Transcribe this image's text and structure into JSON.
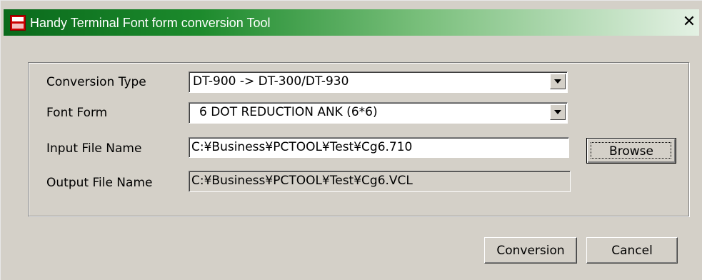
{
  "window": {
    "title": "Handy Terminal Font form conversion Tool",
    "close_symbol": "✕",
    "icon": "app-icon"
  },
  "form": {
    "conversion_type": {
      "label": "Conversion Type",
      "value": "DT-900 -> DT-300/DT-930"
    },
    "font_form": {
      "label": "Font Form",
      "value": "6 DOT REDUCTION ANK (6*6)"
    },
    "input_file": {
      "label": "Input File Name",
      "value": "C:¥Business¥PCTOOL¥Test¥Cg6.710"
    },
    "output_file": {
      "label": "Output File Name",
      "value": "C:¥Business¥PCTOOL¥Test¥Cg6.VCL"
    }
  },
  "buttons": {
    "browse": "Browse",
    "conversion": "Conversion",
    "cancel": "Cancel"
  },
  "colors": {
    "titlebar_start": "#0a6a1c",
    "titlebar_end": "#e4f1e4",
    "face": "#d4d0c8"
  }
}
